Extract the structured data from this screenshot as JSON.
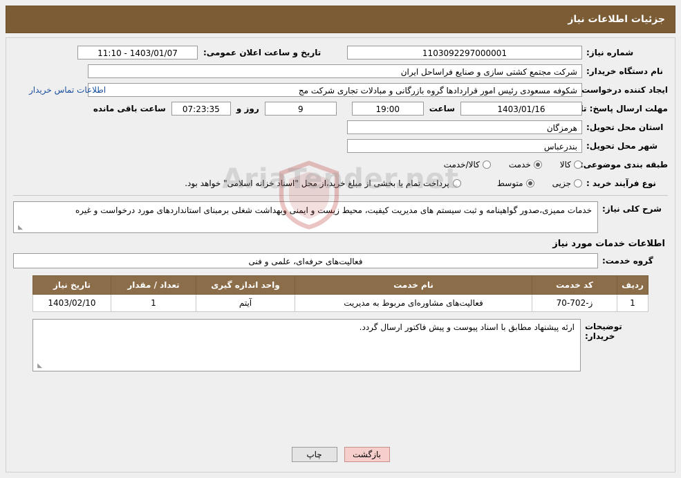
{
  "header": {
    "title": "جزئیات اطلاعات نیاز"
  },
  "fields": {
    "need_number_label": "شماره نیاز:",
    "need_number_value": "1103092297000001",
    "announce_datetime_label": "تاریخ و ساعت اعلان عمومی:",
    "announce_datetime_value": "1403/01/07 - 11:10",
    "buyer_org_label": "نام دستگاه خریدار:",
    "buyer_org_value": "شرکت مجتمع کشتی سازی و صنایع فراساحل ایران",
    "requester_label": "ایجاد کننده درخواست:",
    "requester_value": "شکوفه مسعودی رئیس امور قراردادها گروه بازرگانی و مبادلات تجاری شرکت مج",
    "contact_link": "اطلاعات تماس خریدار",
    "deadline_label": "مهلت ارسال پاسخ: تا تاریخ:",
    "deadline_date": "1403/01/16",
    "hour_label": "ساعت",
    "deadline_time": "19:00",
    "days_value": "9",
    "days_label": "روز و",
    "remaining_time": "07:23:35",
    "remaining_label": "ساعت باقی مانده",
    "province_label": "استان محل تحویل:",
    "province_value": "هرمزگان",
    "city_label": "شهر محل تحویل:",
    "city_value": "بندرعباس",
    "category_label": "طبقه بندی موضوعی:",
    "category_options": [
      "کالا",
      "خدمت",
      "کالا/خدمت"
    ],
    "category_selected": "خدمت",
    "process_label": "نوع فرآیند خرید :",
    "process_options": [
      "جزیی",
      "متوسط"
    ],
    "process_selected": "متوسط",
    "process_note": "پرداخت تمام یا بخشی از مبلغ خرید،از محل \"اسناد خزانه اسلامی\" خواهد بود."
  },
  "description": {
    "label": "شرح کلی نیاز:",
    "text": "خدمات ممیزی،صدور گواهینامه و ثبت سیستم های مدیریت کیفیت، محیط زیست و ایمنی وبهداشت شغلی برمبنای استانداردهای مورد درخواست و غیره"
  },
  "services_section": {
    "title": "اطلاعات خدمات مورد نیاز",
    "group_label": "گروه خدمت:",
    "group_value": "فعالیت‌های حرفه‌ای، علمی و فنی"
  },
  "table": {
    "columns": [
      "ردیف",
      "کد خدمت",
      "نام خدمت",
      "واحد اندازه گیری",
      "تعداد / مقدار",
      "تاریخ نیاز"
    ],
    "rows": [
      {
        "row": "1",
        "code": "ز-702-70",
        "name": "فعالیت‌های مشاوره‌ای مربوط به مدیریت",
        "unit": "آیتم",
        "qty": "1",
        "date": "1403/02/10"
      }
    ]
  },
  "buyer_note": {
    "label": "توضیحات خریدار:",
    "text": "ارئه پیشنهاد مطابق با اسناد پیوست و پیش فاکتور ارسال گردد."
  },
  "buttons": {
    "print": "چاپ",
    "back": "بازگشت"
  },
  "watermark": {
    "text": "AriaTender.net"
  }
}
